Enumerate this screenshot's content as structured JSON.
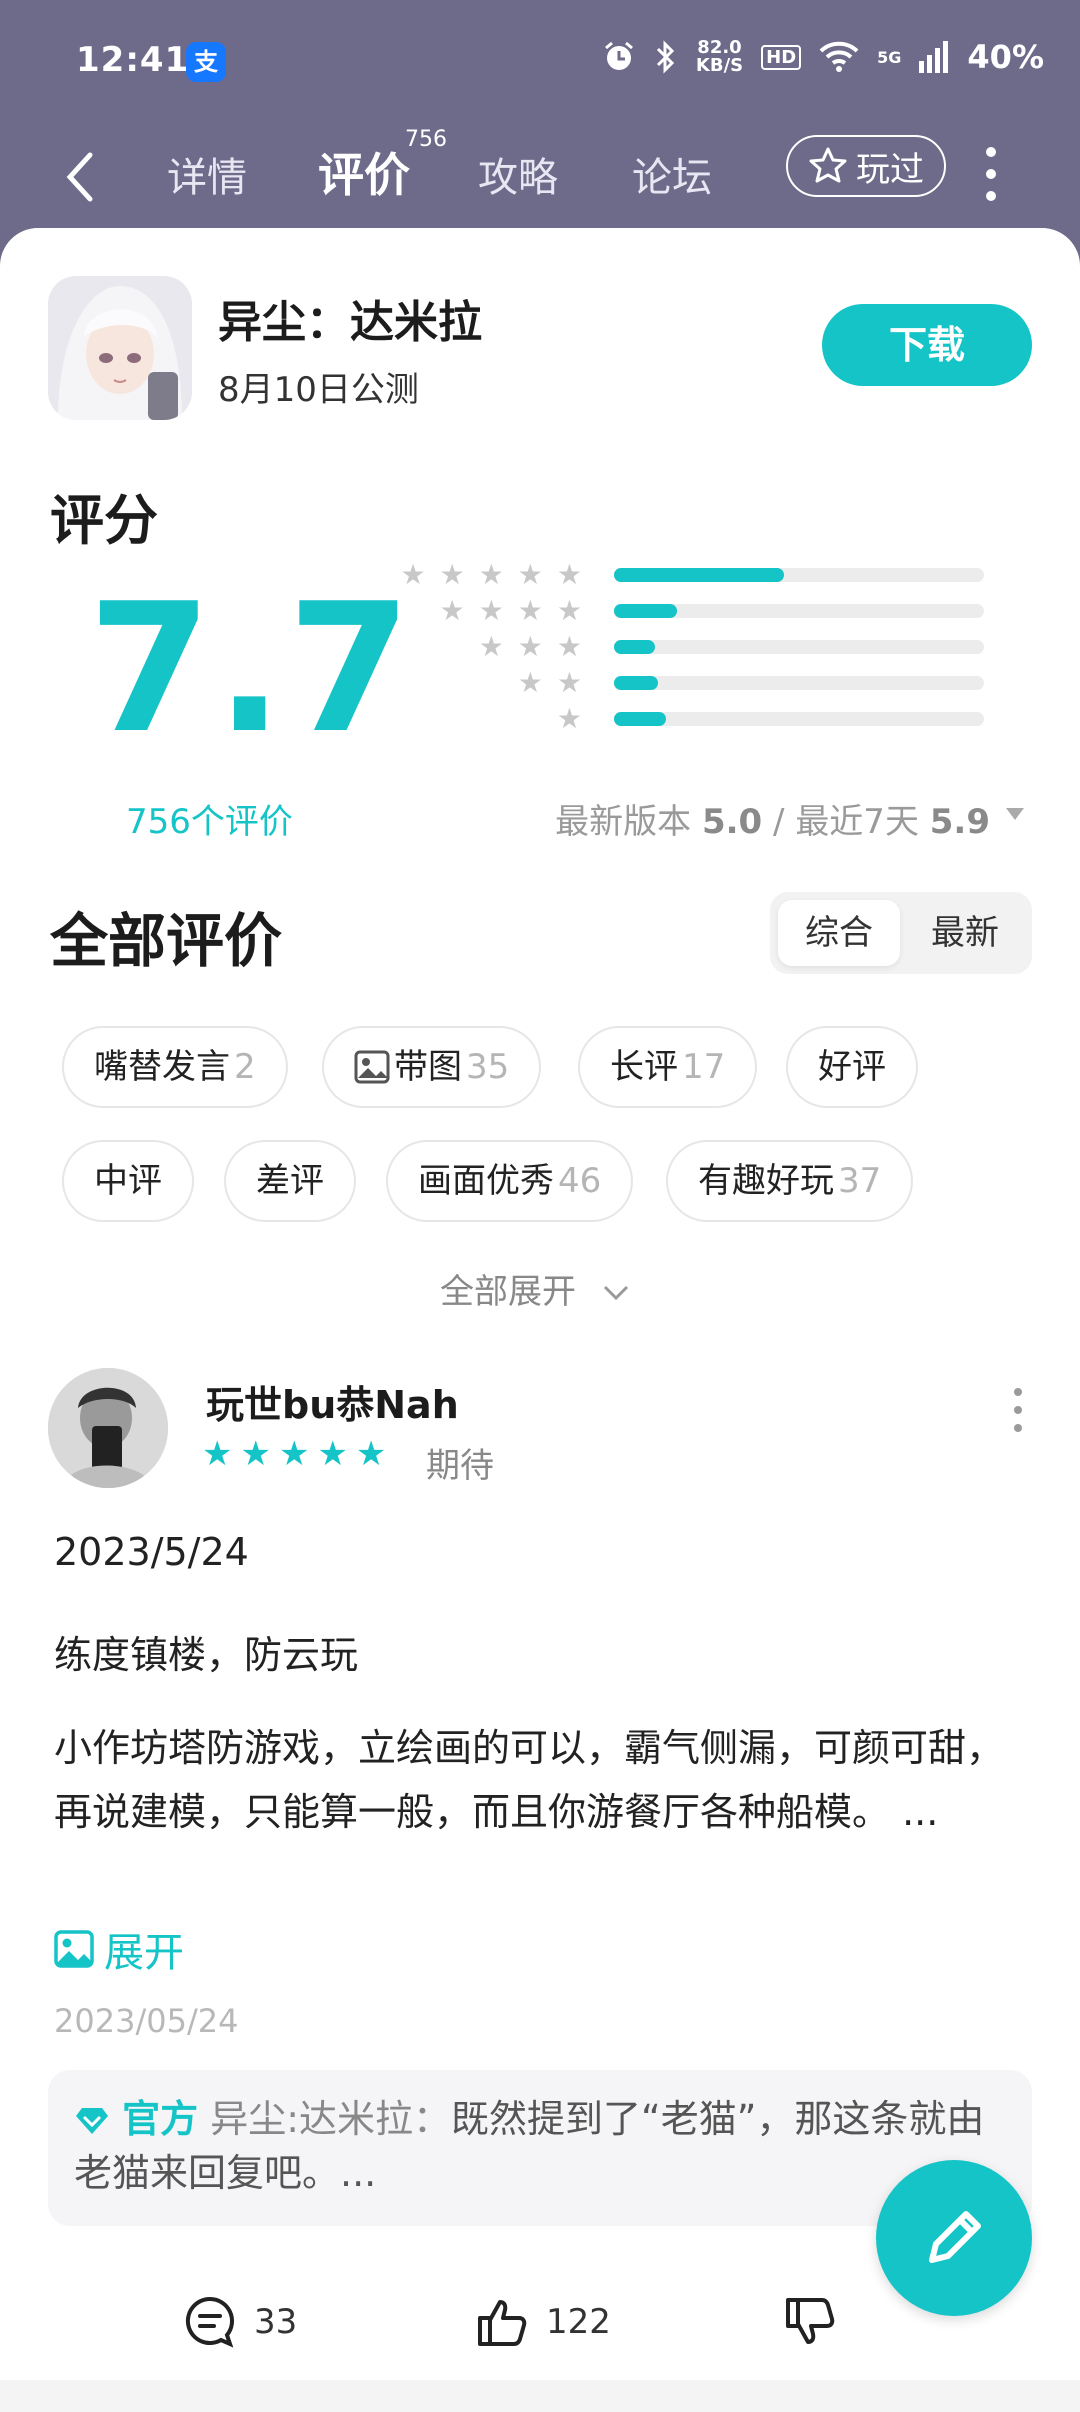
{
  "status": {
    "time": "12:41",
    "app_badge": "支",
    "net_speed": "82.0",
    "net_unit": "KB/S",
    "hd": "HD",
    "network": "5G",
    "battery": "40%"
  },
  "nav": {
    "tabs": [
      {
        "label": "详情"
      },
      {
        "label": "评价",
        "count": "756"
      },
      {
        "label": "攻略"
      },
      {
        "label": "论坛"
      }
    ],
    "played_label": "玩过"
  },
  "game": {
    "title": "异尘：达米拉",
    "subtitle": "8月10日公测",
    "download_label": "下载"
  },
  "rating": {
    "title": "评分",
    "score": "7.7",
    "count_label": "756个评价",
    "distribution": [
      {
        "stars": 5,
        "fraction": 0.46
      },
      {
        "stars": 4,
        "fraction": 0.17
      },
      {
        "stars": 3,
        "fraction": 0.11
      },
      {
        "stars": 2,
        "fraction": 0.12
      },
      {
        "stars": 1,
        "fraction": 0.14
      }
    ],
    "version_prefix": "最新版本",
    "version_score": "5.0",
    "separator": "/",
    "recent_prefix": "最近7天",
    "recent_score": "5.9"
  },
  "reviews": {
    "title": "全部评价",
    "sort": [
      "综合",
      "最新"
    ],
    "chips": [
      {
        "label": "嘴替发言",
        "count": "2"
      },
      {
        "label": "带图",
        "count": "35"
      },
      {
        "label": "长评",
        "count": "17"
      },
      {
        "label": "好评",
        "count": ""
      },
      {
        "label": "中评",
        "count": ""
      },
      {
        "label": "差评",
        "count": ""
      },
      {
        "label": "画面优秀",
        "count": "46"
      },
      {
        "label": "有趣好玩",
        "count": "37"
      }
    ],
    "expand_all": "全部展开"
  },
  "review": {
    "username": "玩世bu恭Nah",
    "stars": "★★★★★",
    "status": "期待",
    "date": "2023/5/24",
    "headline": "练度镇楼，防云玩",
    "body": "小作坊塔防游戏，立绘画的可以，霸气侧漏，可颜可甜，再说建模，只能算一般，而且你游餐厅各种船模。 ...",
    "expand": "展开",
    "posted": "2023/05/24",
    "official_tag": "官方",
    "official_name": "异尘:达米拉：",
    "official_text": "既然提到了“老猫”，那这条就由老猫来回复吧。...",
    "comments": "33",
    "likes": "122"
  }
}
